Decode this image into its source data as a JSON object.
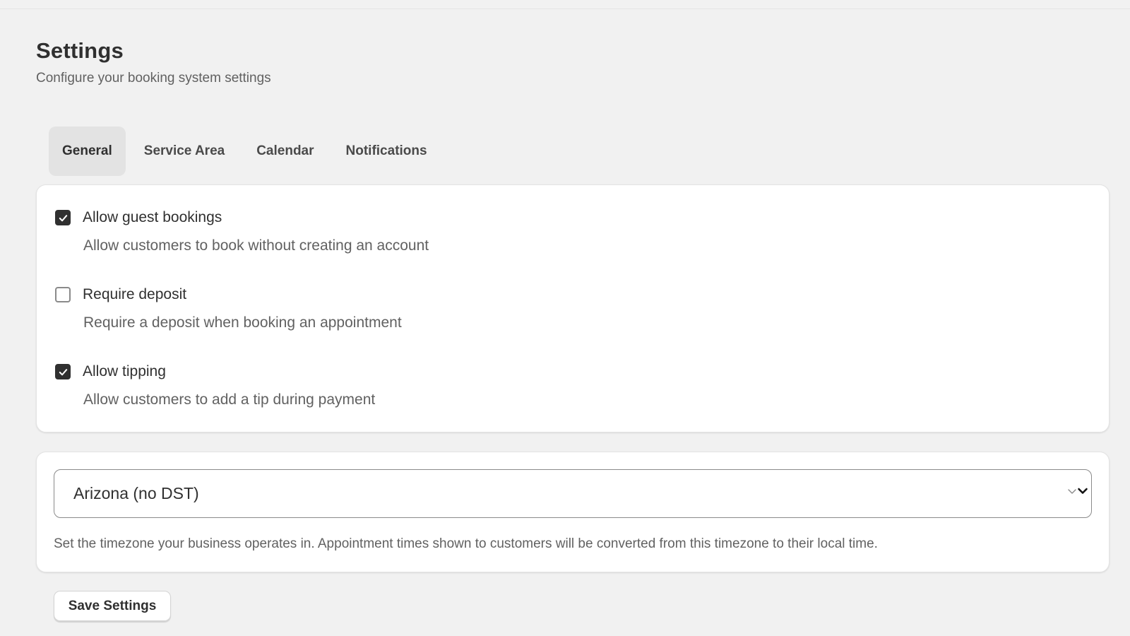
{
  "header": {
    "title": "Settings",
    "subtitle": "Configure your booking system settings"
  },
  "tabs": [
    {
      "label": "General",
      "active": true
    },
    {
      "label": "Service Area",
      "active": false
    },
    {
      "label": "Calendar",
      "active": false
    },
    {
      "label": "Notifications",
      "active": false
    }
  ],
  "options": [
    {
      "label": "Allow guest bookings",
      "description": "Allow customers to book without creating an account",
      "checked": true
    },
    {
      "label": "Require deposit",
      "description": "Require a deposit when booking an appointment",
      "checked": false
    },
    {
      "label": "Allow tipping",
      "description": "Allow customers to add a tip during payment",
      "checked": true
    }
  ],
  "timezone": {
    "selected": "Arizona (no DST)",
    "help": "Set the timezone your business operates in. Appointment times shown to customers will be converted from this timezone to their local time."
  },
  "actions": {
    "save_label": "Save Settings"
  },
  "icons": {
    "checkmark": "checkmark-icon",
    "select_chevron": "chevron-down-icon"
  },
  "colors": {
    "background": "#f1f1f1",
    "card": "#ffffff",
    "checked_fill": "#303030",
    "active_tab": "#e3e3e3",
    "muted_text": "#616161"
  }
}
